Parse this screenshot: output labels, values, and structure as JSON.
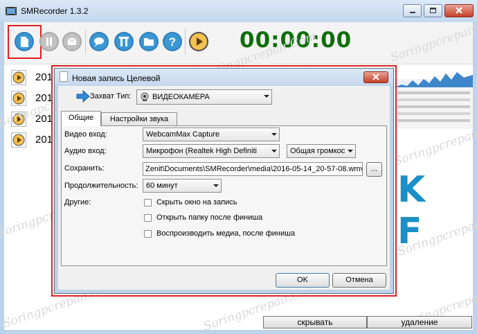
{
  "app": {
    "title": "SMRecorder 1.3.2"
  },
  "toolbar": {
    "timer": "00:00:00",
    "buttons": [
      "new-recording",
      "pause",
      "stop",
      "comment",
      "tools",
      "folder",
      "help",
      "play"
    ]
  },
  "list": {
    "items": [
      "201",
      "201",
      "201",
      "201"
    ]
  },
  "preview_text": "K F",
  "bottom": {
    "hide_label": "скрывать",
    "delete_label": "удаление"
  },
  "watermark": "Soringpcrepair.Com",
  "dialog": {
    "title": "Новая запись Целевой",
    "capture_label": "Захват Тип:",
    "capture_value": "ВИДЕОКАМЕРА",
    "tabs": [
      "Общие",
      "Настройки звука"
    ],
    "video_label": "Видео вход:",
    "video_value": "WebcamMax Capture",
    "audio_label": "Аудио вход:",
    "audio_value": "Микрофон (Realtek High Definiti",
    "audio_volume_value": "Общая громкос",
    "save_label": "Сохранить:",
    "save_path": "Zenit\\Documents\\SMRecorder\\media\\2016-05-14_20-57-08.wmv",
    "browse_label": "...",
    "duration_label": "Продолжительность:",
    "duration_value": "60 минут",
    "other_label": "Другие:",
    "options": [
      "Скрыть окно на запись",
      "Открыть папку после финиша",
      "Воспроизводить медиа, после финиша"
    ],
    "ok_label": "OK",
    "cancel_label": "Отмена"
  },
  "colors": {
    "timer": "#0f6e0a",
    "accent": "#1b8fc7",
    "highlight": "#e02020"
  }
}
